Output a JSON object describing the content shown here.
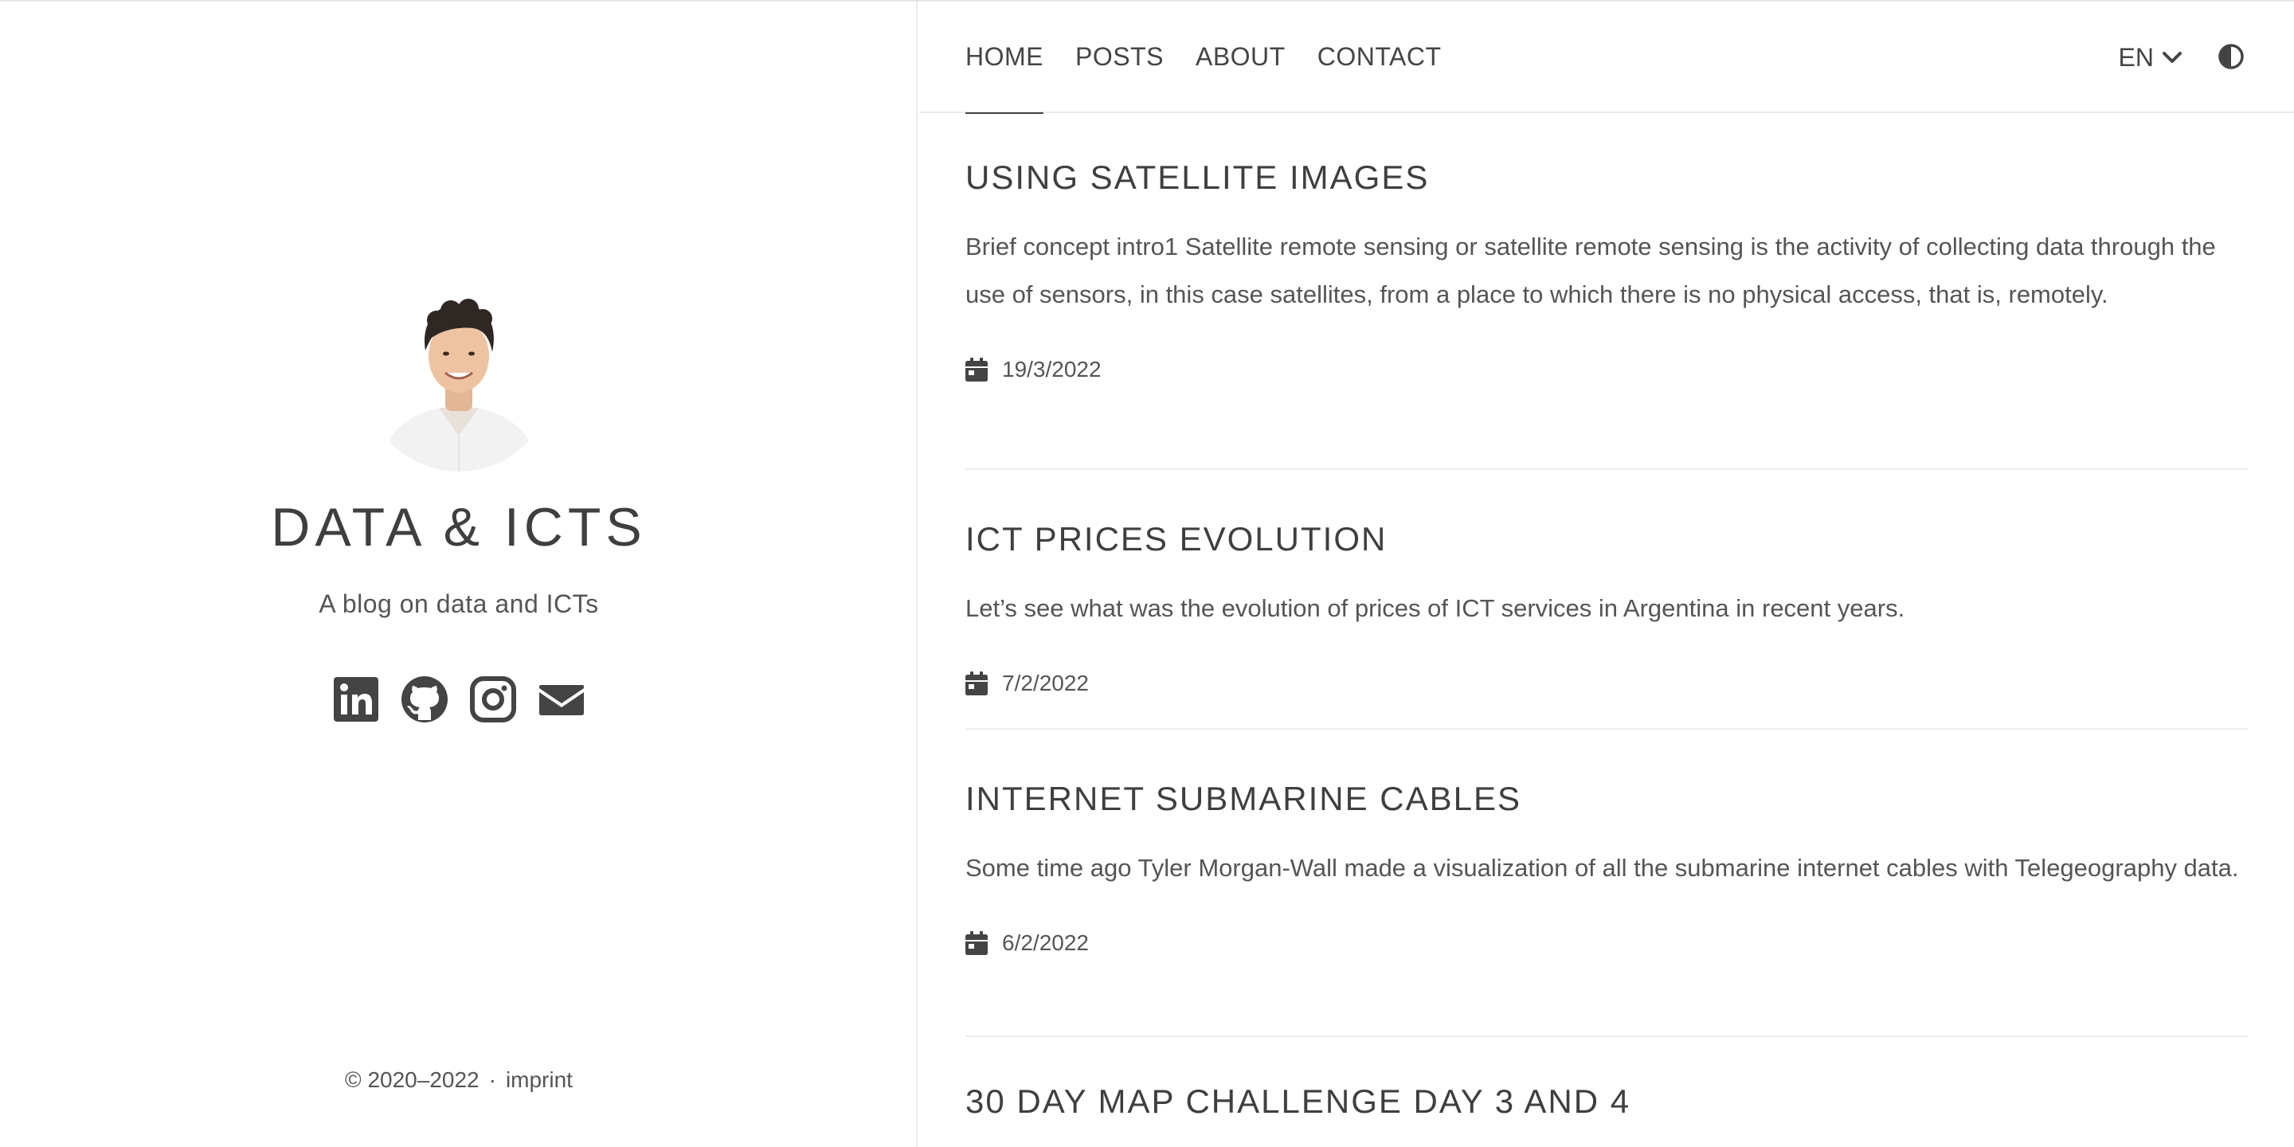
{
  "sidebar": {
    "blog_title": "DATA & ICTS",
    "subtitle": "A blog on data and ICTs",
    "socials": [
      {
        "name": "linkedin",
        "icon": "linkedin-icon"
      },
      {
        "name": "github",
        "icon": "github-icon"
      },
      {
        "name": "instagram",
        "icon": "instagram-icon"
      },
      {
        "name": "email",
        "icon": "envelope-icon"
      }
    ],
    "footer": {
      "copyright": "© 2020–2022",
      "separator": "·",
      "imprint": "imprint"
    }
  },
  "nav": {
    "links": [
      "HOME",
      "POSTS",
      "ABOUT",
      "CONTACT"
    ],
    "active": "HOME",
    "language": "EN",
    "theme_icon": "contrast-icon"
  },
  "posts": [
    {
      "title": "USING SATELLITE IMAGES",
      "excerpt": "Brief concept intro1 Satellite remote sensing or satellite remote sensing is the activity of collecting data through the use of sensors, in this case satellites, from a place to which there is no physical access, that is, remotely.",
      "date": "19/3/2022"
    },
    {
      "title": "ICT PRICES EVOLUTION",
      "excerpt": "Let’s see what was the evolution of prices of ICT services in Argentina in recent years.",
      "date": "7/2/2022"
    },
    {
      "title": "INTERNET SUBMARINE CABLES",
      "excerpt": "Some time ago Tyler Morgan-Wall made a visualization of all the submarine internet cables with Telegeography data.",
      "date": "6/2/2022"
    },
    {
      "title": "30 DAY MAP CHALLENGE DAY 3 AND 4"
    }
  ],
  "colors": {
    "text": "#444444",
    "muted": "#555555",
    "divider": "#ececec"
  }
}
